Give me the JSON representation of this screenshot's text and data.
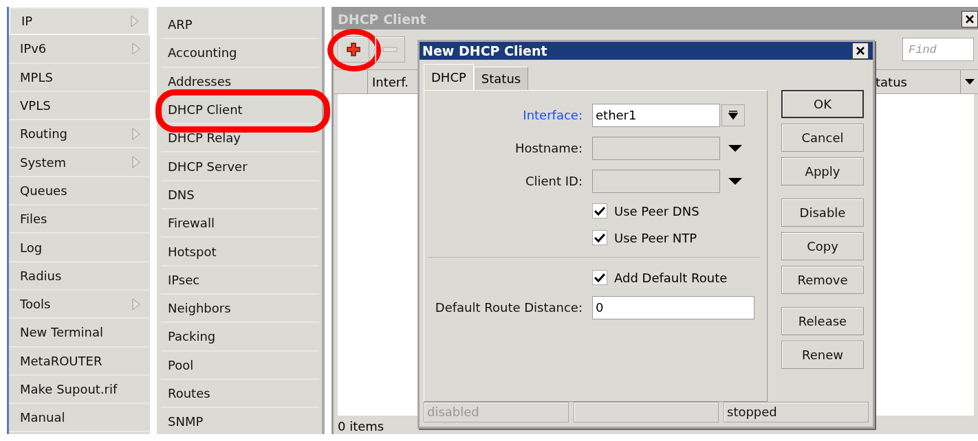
{
  "menu": {
    "items": [
      {
        "label": "IP",
        "submenu": true,
        "selected": true
      },
      {
        "label": "IPv6",
        "submenu": true,
        "selected": false
      },
      {
        "label": "MPLS",
        "submenu": false,
        "selected": false
      },
      {
        "label": "VPLS",
        "submenu": false,
        "selected": false
      },
      {
        "label": "Routing",
        "submenu": true,
        "selected": false
      },
      {
        "label": "System",
        "submenu": true,
        "selected": false
      },
      {
        "label": "Queues",
        "submenu": false,
        "selected": false
      },
      {
        "label": "Files",
        "submenu": false,
        "selected": false
      },
      {
        "label": "Log",
        "submenu": false,
        "selected": false
      },
      {
        "label": "Radius",
        "submenu": false,
        "selected": false
      },
      {
        "label": "Tools",
        "submenu": true,
        "selected": false
      },
      {
        "label": "New Terminal",
        "submenu": false,
        "selected": false
      },
      {
        "label": "MetaROUTER",
        "submenu": false,
        "selected": false
      },
      {
        "label": "Make Supout.rif",
        "submenu": false,
        "selected": false
      },
      {
        "label": "Manual",
        "submenu": false,
        "selected": false
      }
    ]
  },
  "submenu": {
    "items": [
      {
        "label": "ARP",
        "highlighted": false
      },
      {
        "label": "Accounting",
        "highlighted": false
      },
      {
        "label": "Addresses",
        "highlighted": false
      },
      {
        "label": "DHCP Client",
        "highlighted": true
      },
      {
        "label": "DHCP Relay",
        "highlighted": false
      },
      {
        "label": "DHCP Server",
        "highlighted": false
      },
      {
        "label": "DNS",
        "highlighted": false
      },
      {
        "label": "Firewall",
        "highlighted": false
      },
      {
        "label": "Hotspot",
        "highlighted": false
      },
      {
        "label": "IPsec",
        "highlighted": false
      },
      {
        "label": "Neighbors",
        "highlighted": false
      },
      {
        "label": "Packing",
        "highlighted": false
      },
      {
        "label": "Pool",
        "highlighted": false
      },
      {
        "label": "Routes",
        "highlighted": false
      },
      {
        "label": "SNMP",
        "highlighted": false
      }
    ]
  },
  "window": {
    "title": "DHCP Client",
    "toolbar": {
      "add_highlighted": true,
      "find_placeholder": "Find"
    },
    "table": {
      "columns": [
        "Interf.",
        "tatus"
      ]
    },
    "status": "0 items"
  },
  "dialog": {
    "title": "New DHCP Client",
    "tabs": [
      {
        "label": "DHCP",
        "selected": true
      },
      {
        "label": "Status",
        "selected": false
      }
    ],
    "sections": [
      [
        {
          "kind": "field",
          "label": "Interface:",
          "required": true,
          "value": "ether1",
          "list_button": true,
          "dropdown": false,
          "disabled": false
        },
        {
          "kind": "field",
          "label": "Hostname:",
          "required": false,
          "list_button": false,
          "dropdown": true,
          "disabled": true
        },
        {
          "kind": "field",
          "label": "Client ID:",
          "required": false,
          "list_button": false,
          "dropdown": true,
          "disabled": true
        },
        {
          "kind": "checkbox",
          "label": "Use Peer DNS",
          "checked": true
        },
        {
          "kind": "checkbox",
          "label": "Use Peer NTP",
          "checked": true
        }
      ],
      [
        {
          "kind": "checkbox",
          "label": "Add Default Route",
          "checked": true
        },
        {
          "kind": "field",
          "label": "Default Route Distance:",
          "required": false,
          "value": "0",
          "list_button": false,
          "dropdown": false,
          "disabled": false
        }
      ]
    ],
    "buttons": [
      [
        {
          "label": "OK",
          "default": true
        },
        {
          "label": "Cancel",
          "default": false
        },
        {
          "label": "Apply",
          "default": false
        }
      ],
      [
        {
          "label": "Disable",
          "default": false
        },
        {
          "label": "Copy",
          "default": false
        },
        {
          "label": "Remove",
          "default": false
        }
      ],
      [
        {
          "label": "Release",
          "default": false
        },
        {
          "label": "Renew",
          "default": false
        }
      ]
    ],
    "status_bar": [
      {
        "kind": "text",
        "text": "disabled",
        "dim": true
      },
      {
        "kind": "empty"
      },
      {
        "kind": "text",
        "text": "stopped",
        "dim": false
      }
    ]
  }
}
